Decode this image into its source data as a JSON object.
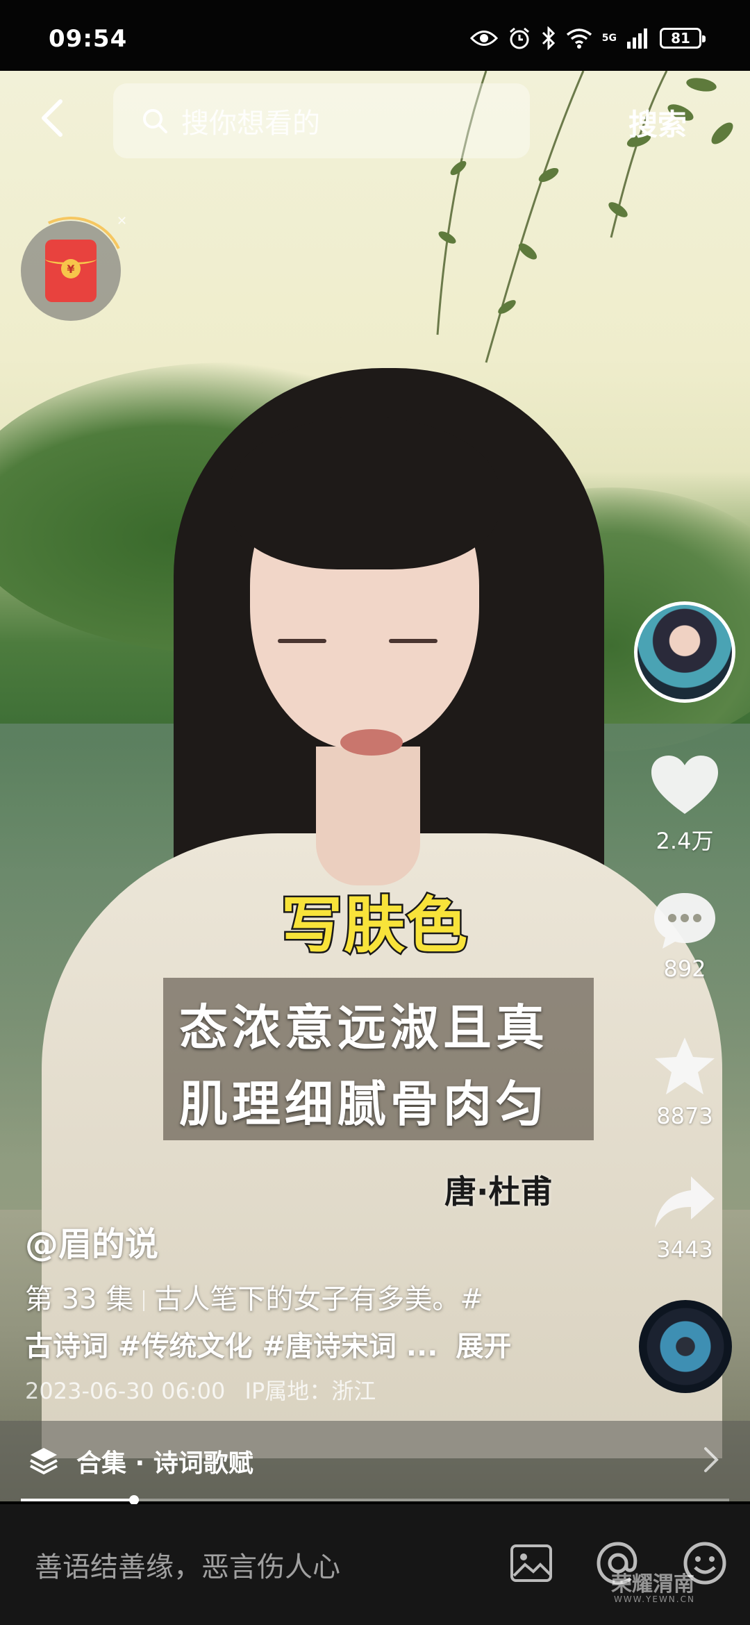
{
  "status_bar": {
    "time": "09:54",
    "network": "5G",
    "battery": "81",
    "icons": [
      "eye-icon",
      "alarm-icon",
      "bluetooth-icon",
      "wifi-icon",
      "signal-icon",
      "battery-icon"
    ]
  },
  "top_bar": {
    "back_icon": "chevron-left-icon",
    "search_placeholder": "搜你想看的",
    "search_button": "搜索"
  },
  "overlay_subtitle": {
    "highlight": "写肤色",
    "lines": [
      "态浓意远淑且真",
      "肌理细腻骨肉匀"
    ],
    "author": "唐·杜甫"
  },
  "side_actions": {
    "like_count": "2.4万",
    "comment_count": "892",
    "favorite_count": "8873",
    "share_count": "3443"
  },
  "caption": {
    "author": "@眉的说",
    "episode": "第 33 集",
    "text": "古人笔下的女子有多美。#",
    "tags": "古诗词 #传统文化 #唐诗宋词 ...",
    "expand": "展开",
    "date": "2023-06-30 06:00",
    "ip": "IP属地：浙江"
  },
  "collection": {
    "label": "合集 · 诗词歌赋"
  },
  "playback_progress": 0.16,
  "comment_bar": {
    "placeholder": "善语结善缘，恶言伤人心"
  },
  "watermark": {
    "text": "荣耀渭南",
    "sub": "WWW.YEWN.CN"
  },
  "colors": {
    "subtitle_yellow": "#f8e33a",
    "red_packet": "#e8423e",
    "bottom_bar": "#161616"
  }
}
